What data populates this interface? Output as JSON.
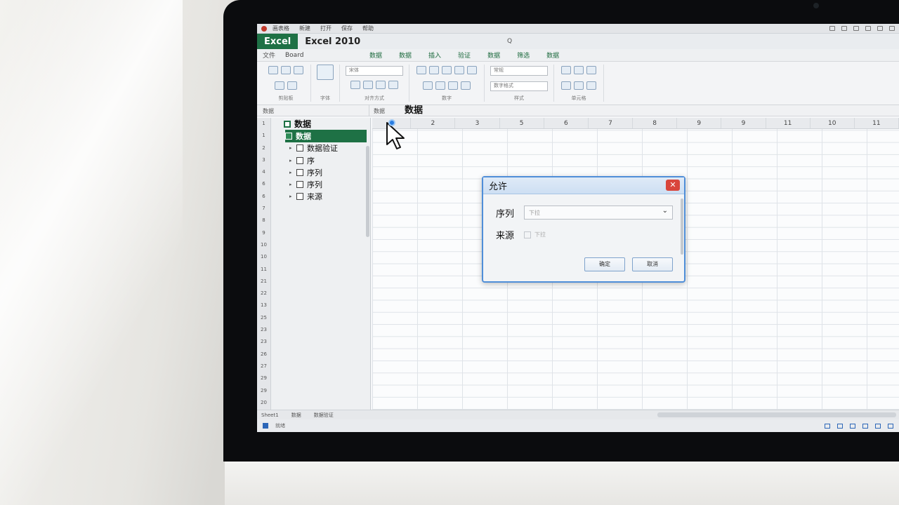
{
  "app": {
    "brand": "Excel",
    "title": "Excel 2010",
    "quick_search": "Q"
  },
  "sysbar": {
    "menus": [
      "画表格",
      "新建",
      "打开",
      "保存",
      "帮助"
    ]
  },
  "toolbar": {
    "file": "文件",
    "font": "Board"
  },
  "ribbon_tabs": [
    "数据",
    "数据",
    "插入",
    "验证",
    "数据",
    "筛选",
    "数据"
  ],
  "ribbon": {
    "groups": [
      "剪贴板",
      "字体",
      "对齐方式",
      "数字",
      "样式",
      "单元格"
    ],
    "font_select": "宋体",
    "format_select": "常规",
    "format_select2": "数字格式"
  },
  "formula_bar": {
    "name_box": "数据",
    "cell_ref": "数据",
    "content": "数据"
  },
  "panel": {
    "root": "数据",
    "selected": "数据",
    "children": [
      "数据验证",
      "序",
      "序列",
      "序列",
      "来源"
    ]
  },
  "row_numbers": [
    "1",
    "1",
    "2",
    "3",
    "4",
    "6",
    "6",
    "7",
    "8",
    "9",
    "10",
    "10",
    "11",
    "21",
    "22",
    "13",
    "25",
    "23",
    "23",
    "26",
    "27",
    "29",
    "29",
    "20"
  ],
  "columns": [
    "1",
    "2",
    "3",
    "5",
    "6",
    "7",
    "8",
    "9",
    "9",
    "11",
    "10",
    "11"
  ],
  "sheet_tabs": [
    "Sheet1",
    "数据",
    "数据验证"
  ],
  "status": {
    "ready": "就绪"
  },
  "dialog": {
    "title": "允许",
    "close": "✕",
    "fields": [
      {
        "label": "序列",
        "value": "下拉"
      },
      {
        "label": "来源",
        "value": "下拉"
      }
    ],
    "ok": "确定",
    "cancel": "取消"
  },
  "icons": [
    "close-icon",
    "chevron-down-icon",
    "pointer-cursor-icon",
    "checkbox-icon"
  ],
  "colors": {
    "brand_green": "#1e7145",
    "dialog_border": "#4f8ed8",
    "close_red": "#d9463c"
  }
}
